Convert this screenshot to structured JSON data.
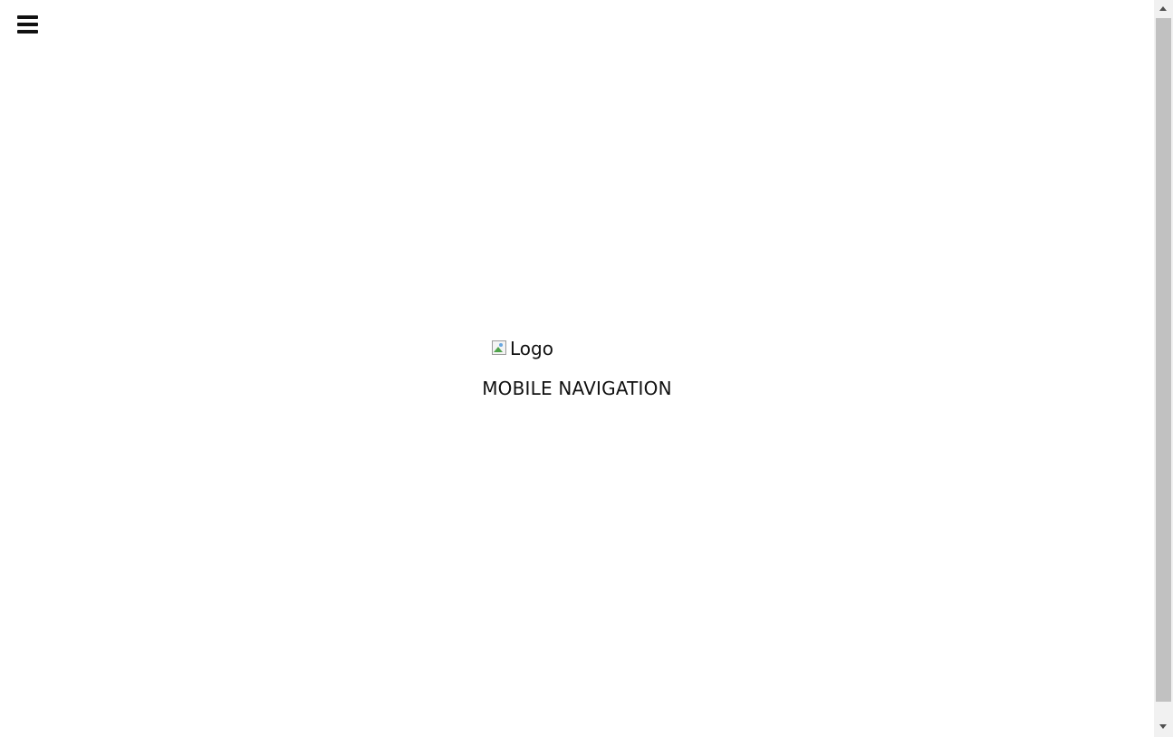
{
  "header": {
    "menu_icon": "hamburger-menu-icon"
  },
  "logo": {
    "alt_text": "Logo",
    "icon": "broken-image-icon"
  },
  "mobile_nav": {
    "title": "MOBILE NAVIGATION"
  },
  "scrollbar": {
    "up_icon": "scroll-up-arrow-icon",
    "down_icon": "scroll-down-arrow-icon"
  }
}
